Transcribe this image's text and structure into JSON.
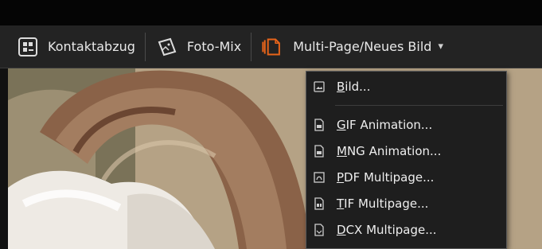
{
  "toolbar": {
    "buttons": [
      {
        "label": "Kontaktabzug",
        "icon": "contact-sheet-icon"
      },
      {
        "label": "Foto-Mix",
        "icon": "photo-mix-icon"
      },
      {
        "label": "Multi-Page/Neues Bild",
        "icon": "multi-page-icon",
        "dropdown_icon": "chevron-down-icon"
      }
    ]
  },
  "menu": {
    "items": [
      {
        "label": "Bild...",
        "mnemonic": "B",
        "icon": "image-icon"
      },
      {
        "label": "GIF Animation...",
        "mnemonic": "G",
        "icon": "gif-file-icon"
      },
      {
        "label": "MNG Animation...",
        "mnemonic": "M",
        "icon": "mng-file-icon"
      },
      {
        "label": "PDF Multipage...",
        "mnemonic": "P",
        "icon": "pdf-file-icon"
      },
      {
        "label": "TIF Multipage...",
        "mnemonic": "T",
        "icon": "tif-file-icon"
      },
      {
        "label": "DCX Multipage...",
        "mnemonic": "D",
        "icon": "dcx-file-icon"
      }
    ]
  },
  "colors": {
    "toolbar_bg": "#232323",
    "menu_bg": "#1e1e1e",
    "accent_orange": "#e8641a"
  }
}
